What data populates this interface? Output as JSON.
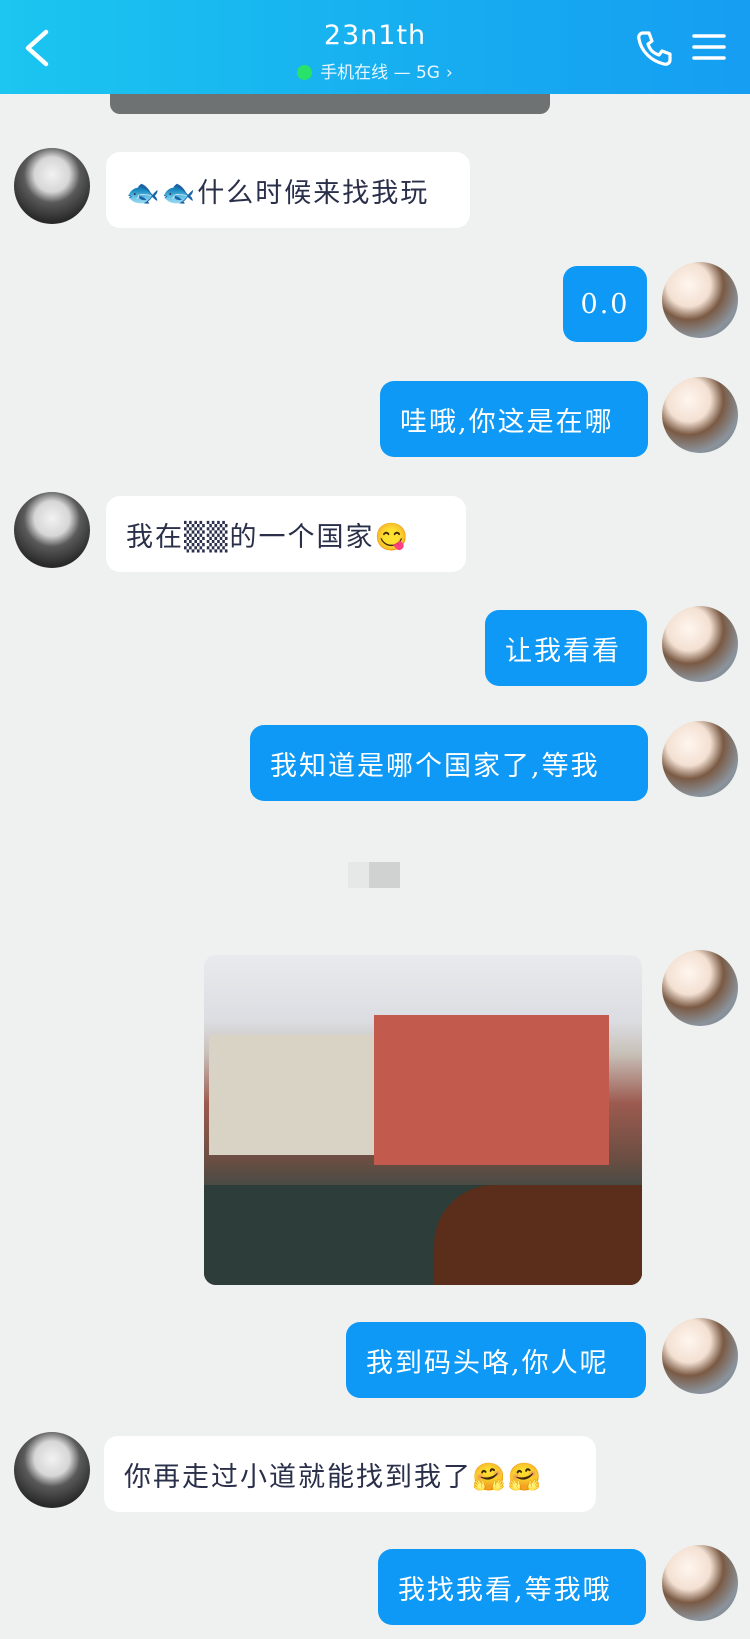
{
  "header": {
    "title": "23n1th",
    "status_text": "手机在线 — 5G",
    "chevron": "›",
    "icons": [
      "back-chevron-icon",
      "phone-icon",
      "menu-icon"
    ]
  },
  "messages": [
    {
      "side": "in",
      "text": "🐟🐟什么时候来找我玩"
    },
    {
      "side": "out",
      "text": "0.0"
    },
    {
      "side": "out",
      "text": "哇哦,你这是在哪"
    },
    {
      "side": "in",
      "text": "我在▒▒的一个国家😋"
    },
    {
      "side": "out",
      "text": "让我看看"
    },
    {
      "side": "out",
      "text": "我知道是哪个国家了,等我"
    },
    {
      "side": "out",
      "text": "我到码头咯,你人呢"
    },
    {
      "side": "in",
      "text": "你再走过小道就能找到我了🤗🤗"
    },
    {
      "side": "out",
      "text": "我找我看,等我哦"
    }
  ],
  "colors": {
    "header_start": "#1bc6f0",
    "header_end": "#169ef2",
    "out_bubble": "#0e99f6",
    "in_bubble": "#ffffff",
    "background": "#eef1f0",
    "online_dot": "#28e36a"
  }
}
